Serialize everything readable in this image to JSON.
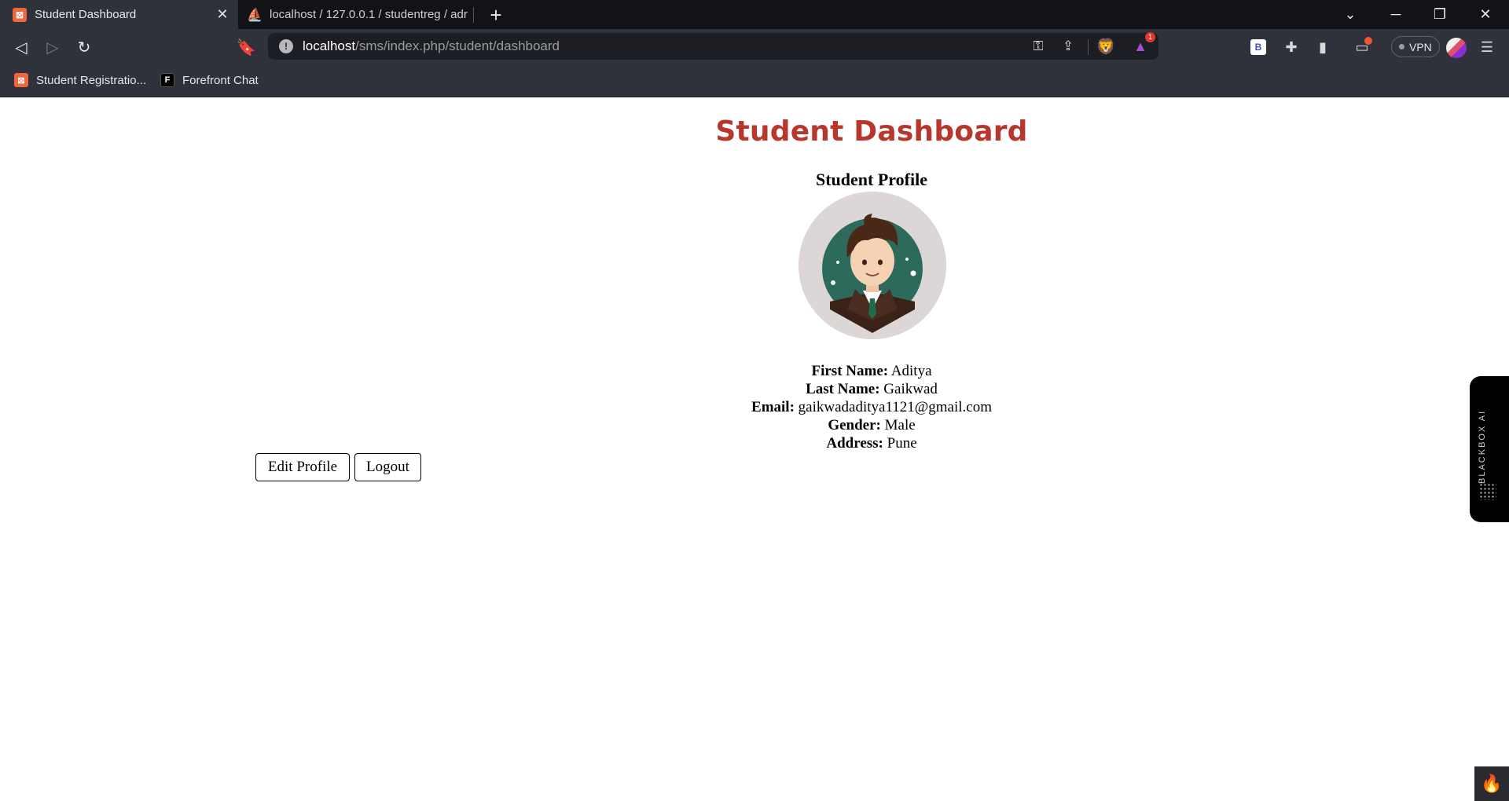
{
  "browser": {
    "tabs": [
      {
        "title": "Student Dashboard",
        "active": true,
        "favicon": "xampp-icon"
      },
      {
        "title": "localhost / 127.0.0.1 / studentreg / adr",
        "active": false,
        "favicon": "phpmyadmin-icon"
      }
    ],
    "url": {
      "host": "localhost",
      "path": "/sms/index.php/student/dashboard"
    },
    "vpn_label": "VPN",
    "rewards_badge": "1",
    "extension_b_label": "B",
    "bookmarks": [
      {
        "label": "Student Registratio...",
        "icon": "xampp-icon"
      },
      {
        "label": "Forefront Chat",
        "icon": "forefront-icon"
      }
    ]
  },
  "page": {
    "title": "Student Dashboard",
    "profile_heading": "Student Profile",
    "fields": {
      "first_name_label": "First Name:",
      "first_name": "Aditya",
      "last_name_label": "Last Name:",
      "last_name": "Gaikwad",
      "email_label": "Email:",
      "email": "gaikwadaditya1121@gmail.com",
      "gender_label": "Gender:",
      "gender": "Male",
      "address_label": "Address:",
      "address": "Pune"
    },
    "buttons": {
      "edit_profile": "Edit Profile",
      "logout": "Logout"
    }
  },
  "overlay": {
    "blackbox_label": "BLACKBOX AI"
  },
  "colors": {
    "title": "#b8372c",
    "chrome_bg": "#2f323b",
    "tabbar_bg": "#121318"
  }
}
